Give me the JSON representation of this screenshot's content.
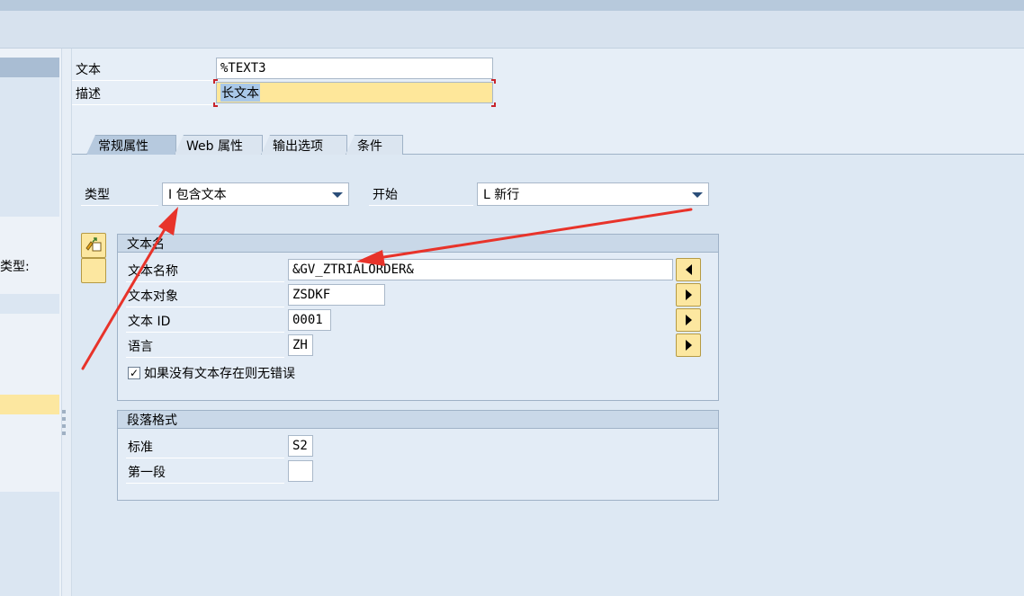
{
  "left_panel": {
    "partial_label": "类型:"
  },
  "header": {
    "text_label": "文本",
    "text_value": "%TEXT3",
    "desc_label": "描述",
    "desc_value": "长文本"
  },
  "tabs": [
    {
      "label": "常规属性",
      "active": true
    },
    {
      "label": "Web 属性",
      "active": false
    },
    {
      "label": "输出选项",
      "active": false
    },
    {
      "label": "条件",
      "active": false
    }
  ],
  "general": {
    "type_label": "类型",
    "type_value": "I 包含文本",
    "start_label": "开始",
    "start_value": "L 新行"
  },
  "text_group": {
    "title": "文本名",
    "name_label": "文本名称",
    "name_value": "&GV_ZTRIALORDER&",
    "object_label": "文本对象",
    "object_value": "ZSDKF",
    "id_label": "文本 ID",
    "id_value": "0001",
    "lang_label": "语言",
    "lang_value": "ZH",
    "no_error_label": "如果没有文本存在则无错误",
    "no_error_checked": "✓"
  },
  "para_group": {
    "title": "段落格式",
    "standard_label": "标准",
    "standard_value": "S2",
    "first_label": "第一段",
    "first_value": ""
  },
  "colors": {
    "annotation_arrow": "#e8332a",
    "required_field": "#fee79a"
  }
}
